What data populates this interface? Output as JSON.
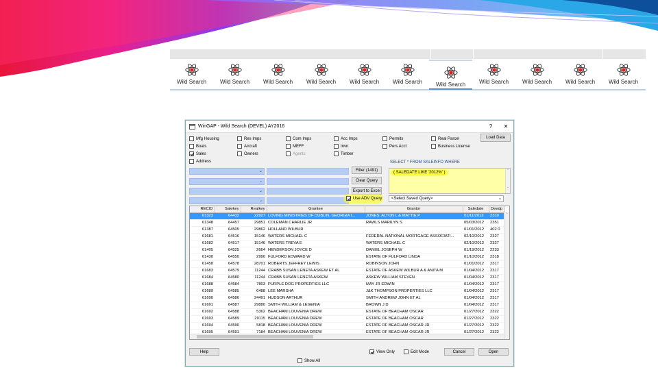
{
  "toolbar": {
    "items": [
      {
        "label": "Wild Search",
        "active": false
      },
      {
        "label": "Wild Search",
        "active": false
      },
      {
        "label": "Wild Search",
        "active": false
      },
      {
        "label": "Wild Search",
        "active": false
      },
      {
        "label": "Wild Search",
        "active": false
      },
      {
        "label": "Wild Search",
        "active": false
      },
      {
        "label": "Wild Search",
        "active": true
      },
      {
        "label": "Wild Search",
        "active": false
      },
      {
        "label": "Wild Search",
        "active": false
      },
      {
        "label": "Wild Search",
        "active": false
      },
      {
        "label": "Wild Search",
        "active": false
      }
    ],
    "icon": "atom-icon"
  },
  "window": {
    "title": "WinGAP - Wild Search (DEVEL) AY2016",
    "help_glyph": "?",
    "close_glyph": "✕"
  },
  "filters": {
    "mfg_housing": "Mfg Housing",
    "boats": "Boats",
    "sales": "Sales",
    "address": "Address",
    "res_imps": "Res Imps",
    "aircraft": "Aircraft",
    "owners": "Owners",
    "com_imps": "Com Imps",
    "meff": "MEFF",
    "agents": "Agents",
    "acc_imps": "Acc Imps",
    "invn": "Invn",
    "timber": "Timber",
    "permits": "Permits",
    "pers_acct": "Pers Acct",
    "real_parcel": "Real Parcel",
    "business_license": "Business License"
  },
  "buttons": {
    "load_data": "Load Data",
    "filter": "Filter (1491)",
    "clear_query": "Clear Query",
    "export_excel": "Export to Excel",
    "help": "Help",
    "cancel": "Cancel",
    "open": "Open"
  },
  "query": {
    "header": "SELECT * FROM SALEINFO WHERE",
    "sql": "( SALEDATE LIKE '2012%' )",
    "use_adv_query": "Use ADV Query",
    "saved_query": "<Select Saved Query>"
  },
  "table": {
    "columns": [
      "RECID",
      "Salekey",
      "Realkey",
      "Grantee",
      "Grantor",
      "Saledate",
      "Deedp"
    ],
    "rows": [
      [
        "61323",
        "64432",
        "22927",
        "LOVING MINISTRIES OF DUBLIN, GEORGIA I...",
        "JONES, ALTON L & MATTIE P",
        "01/11/2012",
        "2319"
      ],
      [
        "61348",
        "64457",
        "29851",
        "COLEMAN CHARLIE JR",
        "RAWLS MARILYN S",
        "05/03/2012",
        "2351"
      ],
      [
        "61387",
        "64505",
        "29862",
        "HOLLAND WILBUR",
        "",
        "01/01/2012",
        "402 0"
      ],
      [
        "61681",
        "64516",
        "15146",
        "WATERS MICHAEL C",
        "FEDERAL NATIONAL MORTGAGE ASSOCIATI...",
        "02/10/2012",
        "2327"
      ],
      [
        "61682",
        "64517",
        "15146",
        "WATERS TREVA E",
        "WATERS MICHAEL C",
        "02/10/2012",
        "2327"
      ],
      [
        "61405",
        "64525",
        "2664",
        "HENDERSON JOYCE D",
        "DANIEL JOSEPH W",
        "01/19/2012",
        "2233"
      ],
      [
        "61430",
        "64550",
        "2990",
        "FULFORD EDWARD W",
        "ESTATE OF FULFORD LINDA",
        "01/10/2012",
        "2318"
      ],
      [
        "61458",
        "64578",
        "28701",
        "ROBERTS JEFFREY LEWIS",
        "ROBINSON JOHN",
        "01/01/2012",
        "2317"
      ],
      [
        "61683",
        "64579",
        "11244",
        "CRABB SUSAN LENETA ASKEW ET AL",
        "ESTATE OF ASKEW WILBUR A & ANITA M",
        "01/04/2012",
        "2317"
      ],
      [
        "61684",
        "64580",
        "11244",
        "CRABB SUSAN LENETA ASKEW",
        "ASKEW WILLIAM STEVEN",
        "01/04/2012",
        "2317"
      ],
      [
        "61688",
        "64584",
        "7803",
        "PURPLE DOG PROPERTIES LLC",
        "MAY JR EDWIN",
        "01/04/2012",
        "2317"
      ],
      [
        "61689",
        "64585",
        "6488",
        "LEE MARSHA",
        "J&K THOMPSON PROPERTIES LLC",
        "01/04/2012",
        "2317"
      ],
      [
        "61690",
        "64586",
        "24491",
        "HUDSON ARTHUR",
        "SMITH ANDREW JOHN ET AL",
        "01/04/2012",
        "2317"
      ],
      [
        "61691",
        "64587",
        "29880",
        "SMITH WILLIAM & LEGENIA",
        "BROWN J D",
        "01/04/2012",
        "2317"
      ],
      [
        "61692",
        "64588",
        "5362",
        "BEACHAM LOUVENIA DREW",
        "ESTATE OF BEACHAM OSCAR",
        "01/27/2012",
        "2322"
      ],
      [
        "61693",
        "64589",
        "29115",
        "BEACHAM LOUVENIA DREW",
        "ESTATE OF BEACHAM OSCAR",
        "01/27/2012",
        "2322"
      ],
      [
        "61694",
        "64590",
        "5818",
        "BEACHAM LOUVENIA DREW",
        "ESTATE OF BEACHAM OSCAR JR",
        "01/27/2012",
        "2322"
      ],
      [
        "61695",
        "64591",
        "7184",
        "BEACHAM LOUVENIA DREW",
        "ESTATE OF BEACHAM OSCAR JR",
        "01/27/2012",
        "2322"
      ]
    ],
    "selected_row": 0
  },
  "footer": {
    "view_only": "View Only",
    "edit_mode": "Edit Mode",
    "show_all": "Show All"
  },
  "colors": {
    "selection": "#3399ff",
    "query_bg": "#ffffa8",
    "highlight": "#ffff33",
    "combo_bg": "#b5cdf5"
  }
}
